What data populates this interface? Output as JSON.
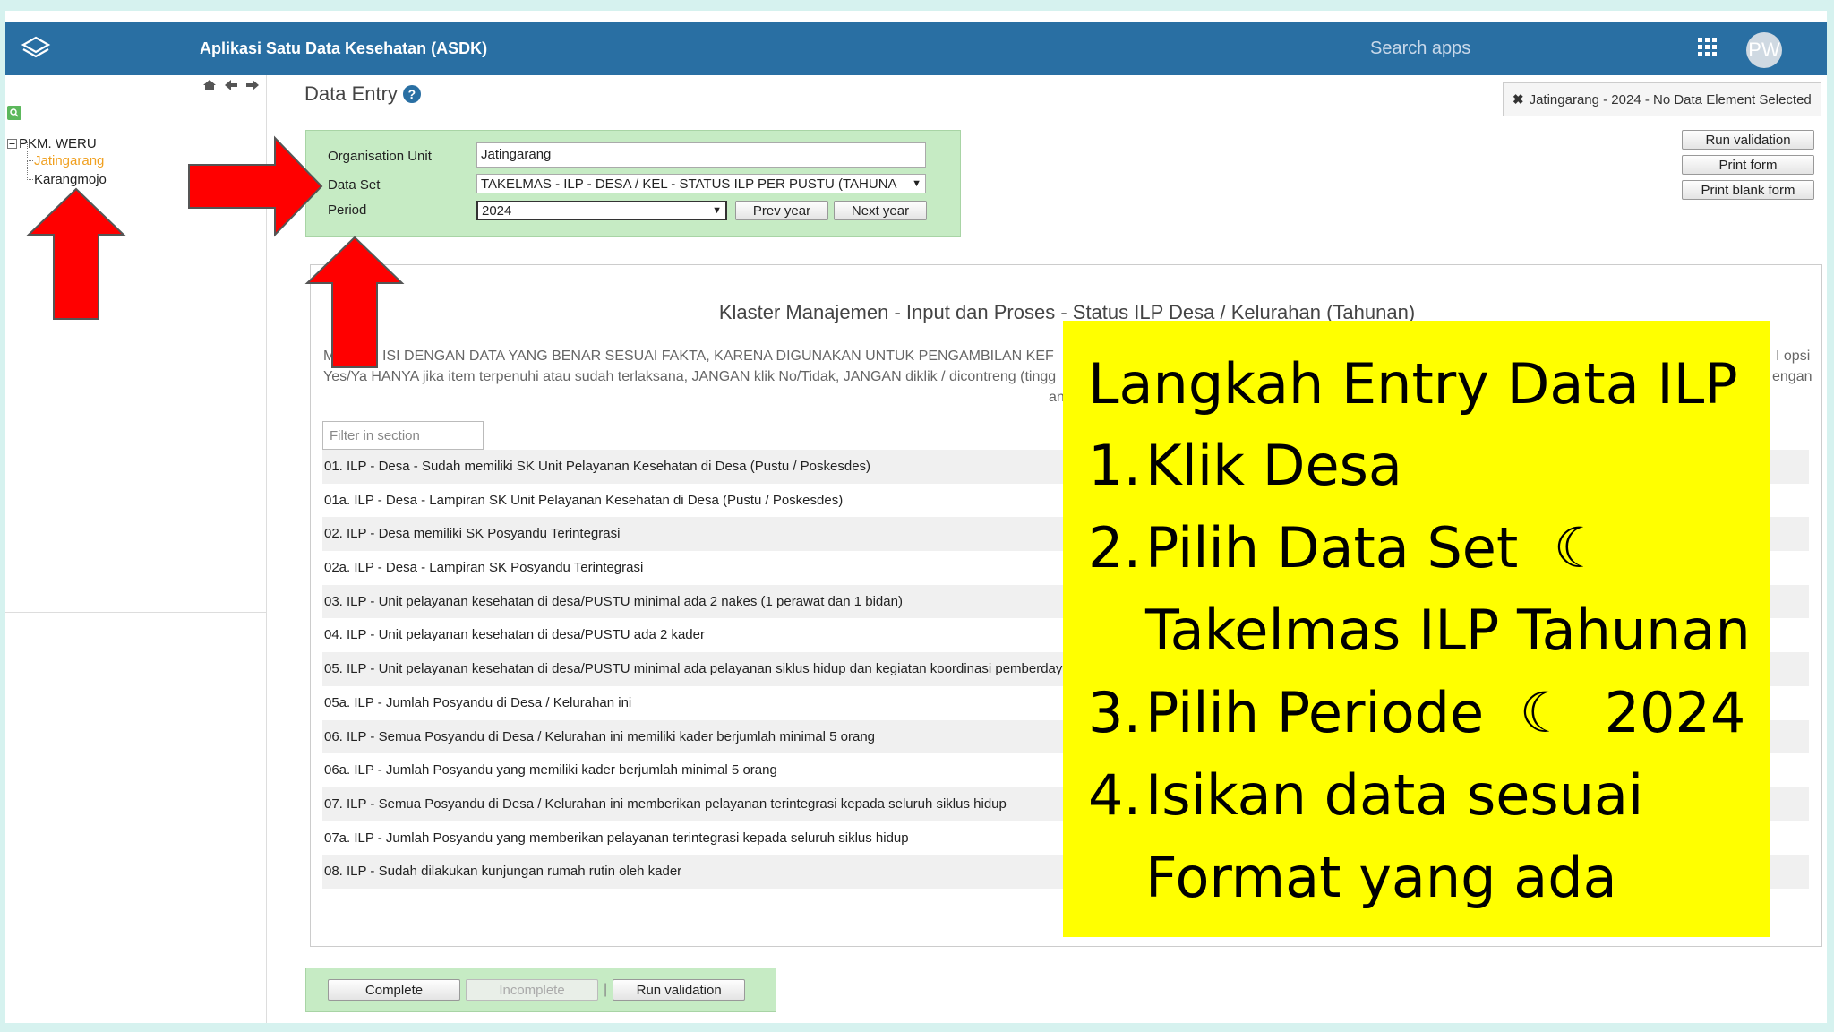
{
  "header": {
    "app_title": "Aplikasi Satu Data Kesehatan (ASDK)",
    "search_placeholder": "Search apps",
    "avatar_initials": "PW"
  },
  "sidebar": {
    "tree_root": "PKM. WERU",
    "children": [
      "Jatingarang",
      "Karangmojo"
    ],
    "selected": "Jatingarang"
  },
  "page": {
    "title": "Data Entry",
    "status": "Jatingarang - 2024 - No Data Element Selected"
  },
  "actions": {
    "run_validation": "Run validation",
    "print_form": "Print form",
    "print_blank_form": "Print blank form"
  },
  "selection": {
    "org_unit_label": "Organisation Unit",
    "org_unit_value": "Jatingarang",
    "data_set_label": "Data Set",
    "data_set_value": "TAKELMAS - ILP - DESA / KEL - STATUS ILP PER PUSTU (TAHUNA",
    "period_label": "Period",
    "period_value": "2024",
    "prev_year": "Prev year",
    "next_year": "Next year"
  },
  "form": {
    "title": "Klaster Manajemen - Input dan Proses - Status ILP Desa / Kelurahan (Tahunan)",
    "note_line1_left": "M",
    "note_line1_mid": "ISI DENGAN DATA YANG BENAR SESUAI FAKTA, KARENA DIGUNAKAN UNTUK PENGAMBILAN KEF",
    "note_line1_right": "I opsi",
    "note_line2_left": "Yes/Ya HANYA jika item terpenuhi atau sudah terlaksana, JANGAN klik No/Tidak, JANGAN diklik / dicontreng (tingg",
    "note_line2_right": "engan",
    "note_line3": "an",
    "filter_placeholder": "Filter in section",
    "items": [
      "01. ILP - Desa - Sudah memiliki SK Unit Pelayanan Kesehatan di Desa (Pustu / Poskesdes)",
      "01a. ILP - Desa - Lampiran SK Unit Pelayanan Kesehatan di Desa (Pustu / Poskesdes)",
      "02. ILP - Desa memiliki SK Posyandu Terintegrasi",
      "02a. ILP - Desa - Lampiran SK Posyandu Terintegrasi",
      "03. ILP - Unit pelayanan kesehatan di desa/PUSTU minimal ada 2 nakes (1 perawat dan 1 bidan)",
      "04. ILP - Unit pelayanan kesehatan di desa/PUSTU ada 2 kader",
      "05. ILP - Unit pelayanan kesehatan di desa/PUSTU minimal ada pelayanan siklus hidup dan kegiatan koordinasi pemberdaya",
      "05a. ILP - Jumlah Posyandu di Desa / Kelurahan ini",
      "06. ILP - Semua Posyandu di Desa / Kelurahan ini memiliki kader berjumlah minimal 5 orang",
      "06a. ILP - Jumlah Posyandu yang memiliki kader berjumlah minimal 5 orang",
      "07. ILP - Semua Posyandu di Desa / Kelurahan ini memberikan pelayanan terintegrasi kepada seluruh siklus hidup",
      "07a. ILP - Jumlah Posyandu yang memberikan pelayanan terintegrasi kepada seluruh siklus hidup",
      "08. ILP - Sudah dilakukan kunjungan rumah rutin oleh kader"
    ]
  },
  "bottom": {
    "complete": "Complete",
    "incomplete": "Incomplete",
    "separator": "|",
    "run_validation": "Run validation"
  },
  "overlay": {
    "title": "Langkah Entry Data ILP",
    "steps": [
      {
        "num": "1.",
        "text": "Klik Desa"
      },
      {
        "num": "2.",
        "text": "Pilih Data Set  ☾\nTakelmas ILP Tahunan"
      },
      {
        "num": "3.",
        "text": "Pilih Periode  ☾  2024"
      },
      {
        "num": "4.",
        "text": "Isikan data sesuai\nFormat yang ada"
      }
    ]
  },
  "colors": {
    "topbar": "#296fa3",
    "panel_green": "#c6ebc4",
    "overlay_yellow": "#ffff00",
    "arrow_red": "#ff0000",
    "selected_orange": "#f0a020"
  }
}
